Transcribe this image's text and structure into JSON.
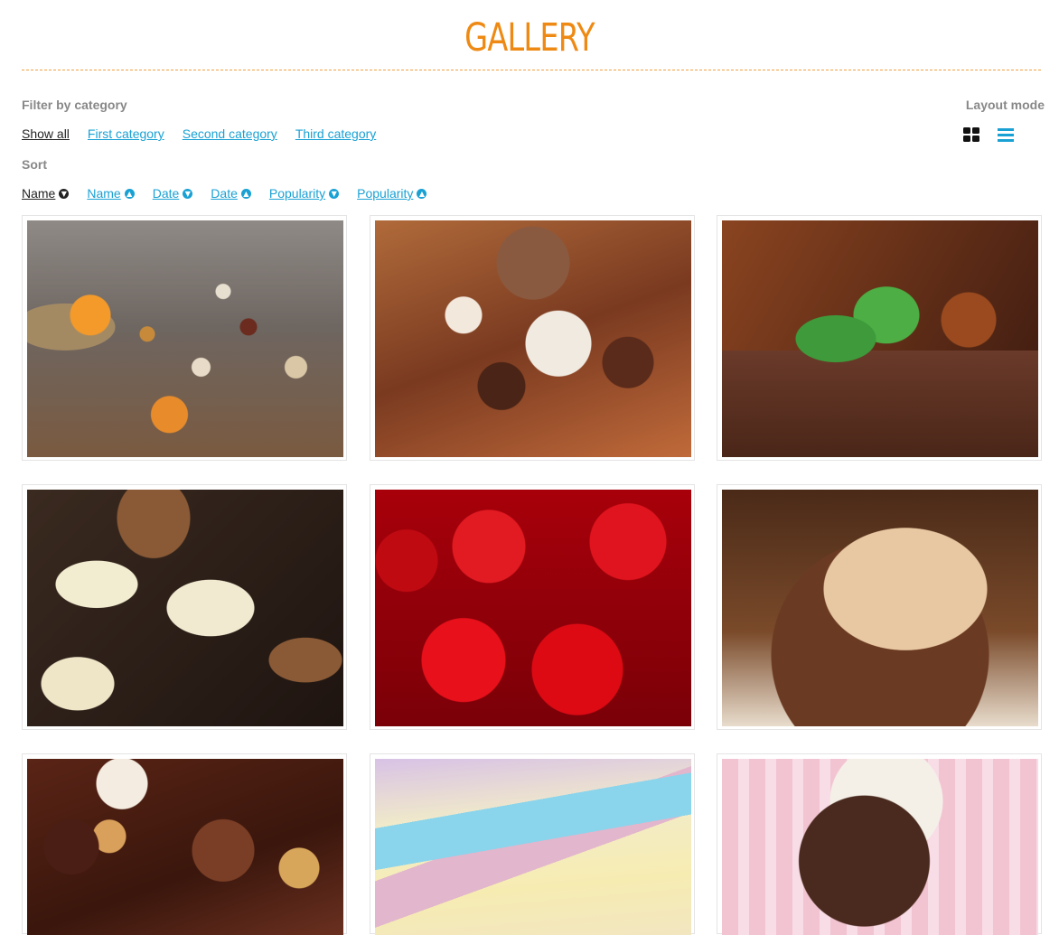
{
  "header": {
    "title": "GALLERY"
  },
  "filter": {
    "label": "Filter by category",
    "items": [
      "Show all",
      "First category",
      "Second category",
      "Third category"
    ],
    "active": "Show all"
  },
  "sort": {
    "label": "Sort",
    "items": [
      {
        "label": "Name",
        "direction": "down"
      },
      {
        "label": "Name",
        "direction": "up"
      },
      {
        "label": "Date",
        "direction": "down"
      },
      {
        "label": "Date",
        "direction": "up"
      },
      {
        "label": "Popularity",
        "direction": "down"
      },
      {
        "label": "Popularity",
        "direction": "up"
      }
    ],
    "active_index": 0
  },
  "layout": {
    "label": "Layout mode",
    "modes": [
      "grid-icon",
      "list-icon"
    ],
    "active": "grid-icon"
  },
  "gallery": {
    "items": [
      {
        "subject": "dried fruits and nuts"
      },
      {
        "subject": "chocolate truffles with cinnamon"
      },
      {
        "subject": "chocolate with mint and star anise"
      },
      {
        "subject": "chocolate pralines with nuts"
      },
      {
        "subject": "candied apples on sticks"
      },
      {
        "subject": "chocolate cupcake"
      },
      {
        "subject": "assorted chocolate candies"
      },
      {
        "subject": "pastel marshmallow twists"
      },
      {
        "subject": "cake pops"
      }
    ]
  },
  "colors": {
    "title": "#ee8a14",
    "link": "#1aa1d4",
    "active_link": "#222222",
    "label": "#888888"
  }
}
